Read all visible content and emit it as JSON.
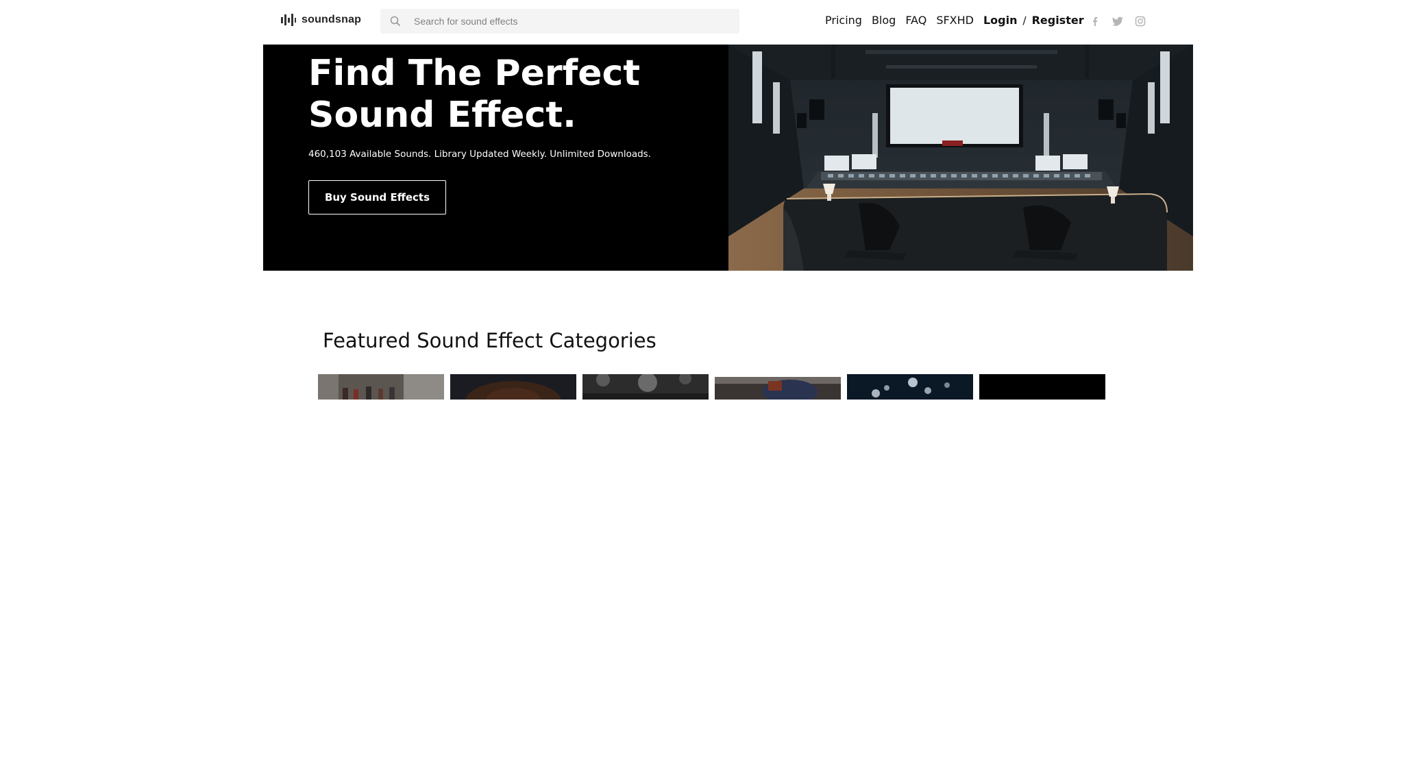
{
  "header": {
    "logo_text": "soundsnap",
    "search_placeholder": "Search for sound effects",
    "nav": {
      "pricing": "Pricing",
      "blog": "Blog",
      "faq": "FAQ",
      "sfxhd": "SFXHD",
      "login": "Login",
      "separator": "/",
      "register": "Register"
    },
    "social_icons": [
      "facebook-icon",
      "twitter-icon",
      "instagram-icon"
    ]
  },
  "hero": {
    "title": "Find The Perfect Sound Effect.",
    "subtitle": "460,103 Available Sounds. Library Updated Weekly. Unlimited Downloads.",
    "button_label": "Buy Sound Effects"
  },
  "featured": {
    "title": "Featured Sound Effect Categories",
    "category_count": 6
  },
  "colors": {
    "hero_background": "#000000",
    "search_background": "#f4f4f4",
    "text": "#111111",
    "social_icon": "#b5b5b5"
  }
}
